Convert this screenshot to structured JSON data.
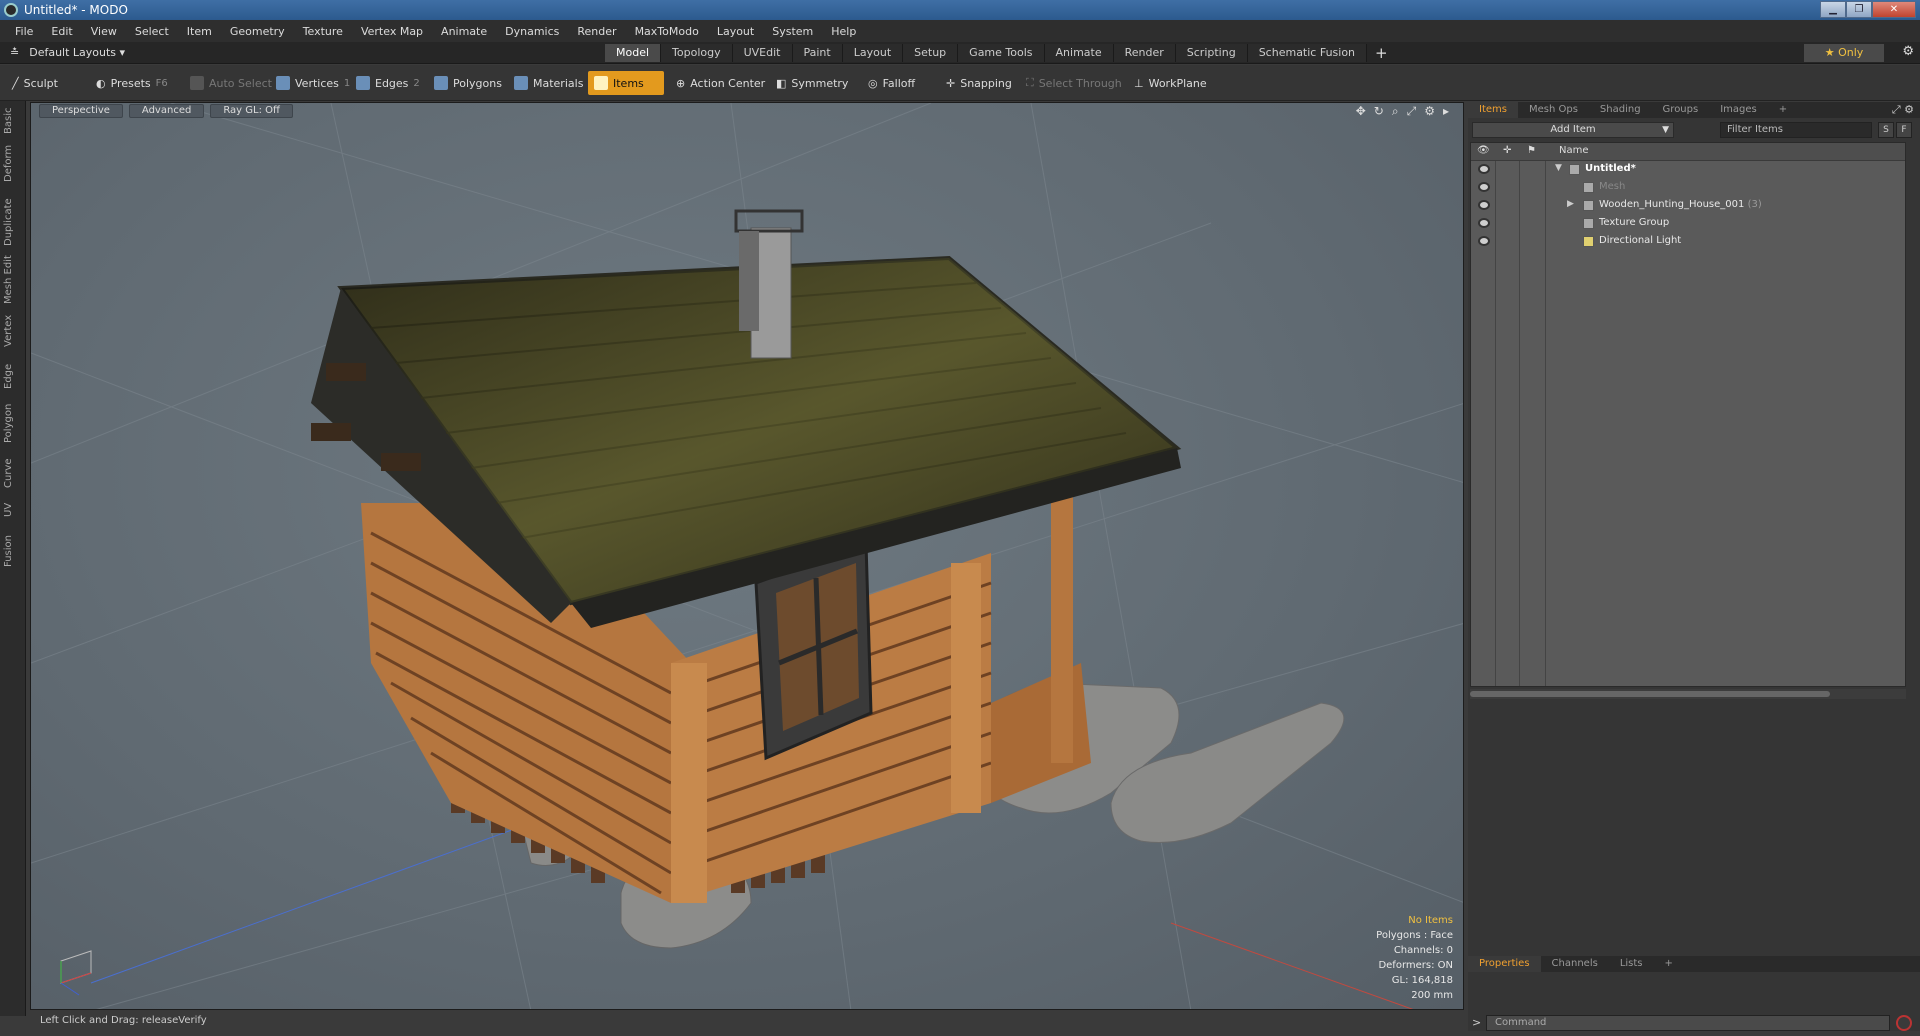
{
  "window": {
    "title": "Untitled* - MODO"
  },
  "menu": [
    "File",
    "Edit",
    "View",
    "Select",
    "Item",
    "Geometry",
    "Texture",
    "Vertex Map",
    "Animate",
    "Dynamics",
    "Render",
    "MaxToModo",
    "Layout",
    "System",
    "Help"
  ],
  "layout_bar": {
    "default_layouts": "Default Layouts ▾",
    "tabs": [
      "Model",
      "Topology",
      "UVEdit",
      "Paint",
      "Layout",
      "Setup",
      "Game Tools",
      "Animate",
      "Render",
      "Scripting",
      "Schematic Fusion"
    ],
    "active_tab": "Model",
    "only_label": "★ Only"
  },
  "toolbar": {
    "sculpt": "Sculpt",
    "presets": "Presets",
    "presets_key": "F6",
    "auto_select": "Auto Select",
    "vertices": "Vertices",
    "vertices_key": "1",
    "edges": "Edges",
    "edges_key": "2",
    "polygons": "Polygons",
    "materials": "Materials",
    "items": "Items",
    "action_center": "Action Center",
    "symmetry": "Symmetry",
    "falloff": "Falloff",
    "snapping": "Snapping",
    "select_through": "Select Through",
    "workplane": "WorkPlane"
  },
  "left_tabs": [
    "Basic",
    "Deform",
    "Duplicate",
    "Mesh Edit",
    "Vertex",
    "Edge",
    "Polygon",
    "Curve",
    "UV",
    "Fusion"
  ],
  "viewport": {
    "perspective": "Perspective",
    "advanced": "Advanced",
    "raygl": "Ray GL: Off",
    "stats": {
      "no_items": "No Items",
      "polygons": "Polygons : Face",
      "channels": "Channels: 0",
      "deformers": "Deformers: ON",
      "gl": "GL: 164,818",
      "scale": "200 mm"
    }
  },
  "status": {
    "hint": "Left Click and Drag:  releaseVerify"
  },
  "items_panel": {
    "tabs": [
      "Items",
      "Mesh Ops",
      "Shading",
      "Groups",
      "Images"
    ],
    "active_tab": "Items",
    "add_item": "Add Item",
    "filter": "Filter Items",
    "s_btn": "S",
    "f_btn": "F",
    "name_header": "Name",
    "rows": [
      {
        "label": "Untitled*",
        "suffix": ""
      },
      {
        "label": "Mesh",
        "suffix": ""
      },
      {
        "label": "Wooden_Hunting_House_001",
        "suffix": "(3)"
      },
      {
        "label": "Texture Group",
        "suffix": ""
      },
      {
        "label": "Directional Light",
        "suffix": ""
      }
    ]
  },
  "properties_panel": {
    "tabs": [
      "Properties",
      "Channels",
      "Lists"
    ],
    "active_tab": "Properties",
    "command_placeholder": "Command"
  },
  "colors": {
    "accent": "#e39a1e",
    "active_tab_text": "#f0a030",
    "warn": "#f0c040"
  }
}
